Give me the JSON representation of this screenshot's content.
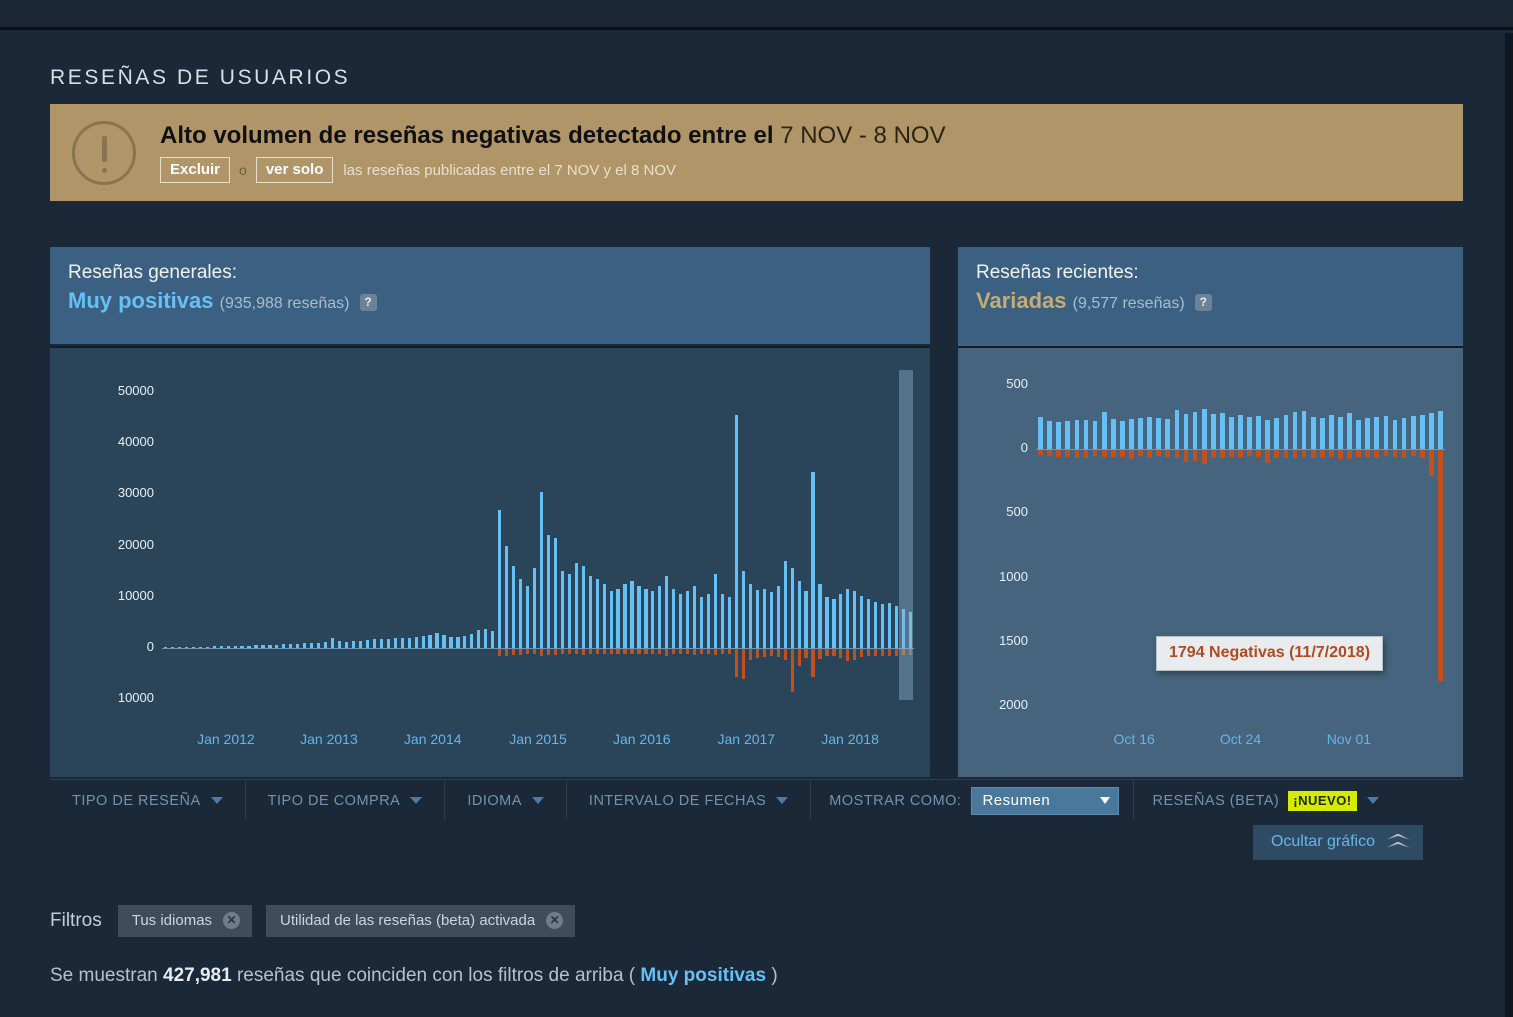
{
  "section": {
    "title": "RESEÑAS DE USUARIOS"
  },
  "warning": {
    "icon": "exclamation-circle-icon",
    "headline_bold": "Alto volumen de reseñas negativas detectado entre el ",
    "headline_range": "7 NOV - 8 NOV",
    "exclude_label": "Excluir",
    "or_label": "o",
    "only_label": "ver solo",
    "tail_text": "las reseñas publicadas entre el 7 NOV y el 8 NOV",
    "bg_color": "#b09569"
  },
  "overall": {
    "heading": "Reseñas generales:",
    "score": "Muy positivas",
    "count": "(935,988 reseñas)",
    "help_icon": "question-mark-icon",
    "score_color": "#66c0f4"
  },
  "recent": {
    "heading": "Reseñas recientes:",
    "score": "Variadas",
    "count": "(9,577 reseñas)",
    "help_icon": "question-mark-icon",
    "score_color": "#c7ab71"
  },
  "filter_bar": {
    "review_type": "TIPO DE RESEÑA",
    "purchase_type": "TIPO DE COMPRA",
    "language": "IDIOMA",
    "date_range": "INTERVALO DE FECHAS",
    "show_as_label": "MOSTRAR COMO:",
    "show_as_value": "Resumen",
    "show_as_options": [
      "Resumen"
    ],
    "beta_label": "RESEÑAS (BETA)",
    "beta_badge": "¡NUEVO!",
    "hide_graph": "Ocultar gráfico"
  },
  "filters": {
    "label": "Filtros",
    "chips": [
      {
        "text": "Tus idiomas",
        "remove_icon": "close-icon"
      },
      {
        "text": "Utilidad de las reseñas (beta) activada",
        "remove_icon": "close-icon"
      }
    ]
  },
  "summary": {
    "prefix": "Se muestran ",
    "count": "427,981",
    "middle": " reseñas que coinciden con los filtros de arriba ( ",
    "link": "Muy positivas",
    "suffix": " )"
  },
  "chart_data": [
    {
      "id": "overall-reviews-chart",
      "type": "bar",
      "title": "Reseñas generales",
      "xlabel": "",
      "ylabel": "",
      "grid": false,
      "legend": "none",
      "yticks": [
        "50000",
        "40000",
        "30000",
        "20000",
        "10000",
        "0",
        "10000"
      ],
      "ytick_values": [
        50000,
        40000,
        30000,
        20000,
        10000,
        0,
        -10000
      ],
      "ylim": [
        -14000,
        54000
      ],
      "xticks": [
        "Jan 2012",
        "Jan 2013",
        "Jan 2014",
        "Jan 2015",
        "Jan 2016",
        "Jan 2017",
        "Jan 2018"
      ],
      "colors": {
        "positive": "#66c0f4",
        "negative": "#c0501e"
      },
      "selection_highlight": "last month range",
      "series": [
        {
          "name": "Positivas",
          "color": "#66c0f4",
          "values": [
            120,
            130,
            140,
            150,
            160,
            170,
            200,
            260,
            300,
            280,
            320,
            330,
            360,
            420,
            480,
            520,
            560,
            600,
            700,
            760,
            820,
            880,
            940,
            1000,
            1900,
            1200,
            1150,
            1250,
            1350,
            1500,
            1600,
            1700,
            1750,
            1800,
            1850,
            1900,
            2100,
            2300,
            2500,
            2800,
            2400,
            2000,
            2100,
            2200,
            2600,
            3400,
            3600,
            3200,
            27000,
            20000,
            16000,
            13500,
            12000,
            15500,
            30500,
            22000,
            21500,
            15000,
            14500,
            16500,
            16000,
            14000,
            13500,
            12500,
            11000,
            11500,
            12500,
            13000,
            12000,
            11500,
            11000,
            12000,
            14000,
            11500,
            10500,
            11000,
            12000,
            10000,
            10500,
            14500,
            10500,
            10000,
            45500,
            15000,
            12500,
            11200,
            11500,
            10800,
            12000,
            17000,
            15500,
            13000,
            11000,
            34500,
            12500,
            10000,
            9500,
            10500,
            11500,
            11000,
            10200,
            9500,
            9000,
            8500,
            8800,
            8200,
            7500,
            7000
          ]
        },
        {
          "name": "Negativas",
          "color": "#c0501e",
          "values": [
            0,
            0,
            0,
            0,
            0,
            0,
            0,
            0,
            0,
            0,
            0,
            0,
            0,
            0,
            0,
            0,
            0,
            0,
            0,
            0,
            0,
            0,
            0,
            0,
            0,
            0,
            0,
            0,
            0,
            0,
            0,
            0,
            0,
            0,
            0,
            0,
            0,
            0,
            0,
            0,
            0,
            0,
            0,
            0,
            0,
            0,
            0,
            0,
            1500,
            1400,
            1300,
            1200,
            1100,
            1100,
            1500,
            1300,
            1200,
            1100,
            1100,
            1100,
            1200,
            1100,
            1000,
            1000,
            1000,
            1000,
            1100,
            1100,
            1100,
            1100,
            1000,
            1100,
            1400,
            1100,
            1000,
            1100,
            1200,
            1000,
            1100,
            1200,
            1100,
            1100,
            5500,
            6000,
            2200,
            1800,
            1600,
            1500,
            1700,
            2200,
            8500,
            3500,
            1900,
            5500,
            2000,
            1400,
            1500,
            1800,
            2400,
            2200,
            1600,
            1500,
            1400,
            1500,
            1500,
            1400,
            1300,
            1200
          ]
        }
      ]
    },
    {
      "id": "recent-reviews-chart",
      "type": "bar",
      "title": "Reseñas recientes",
      "xlabel": "",
      "ylabel": "",
      "grid": false,
      "legend": "none",
      "yticks": [
        "500",
        "0",
        "500",
        "1000",
        "1500",
        "2000"
      ],
      "ytick_values": [
        500,
        0,
        -500,
        -1000,
        -1500,
        -2000
      ],
      "ylim": [
        -2100,
        600
      ],
      "xticks": [
        "Oct 16",
        "Oct 24",
        "Nov 01"
      ],
      "colors": {
        "positive": "#66c0f4",
        "negative": "#c0501e"
      },
      "annotation": {
        "text": "1794 Negativas (11/7/2018)",
        "color": "#b04a23"
      },
      "series": [
        {
          "name": "Positivas",
          "color": "#66c0f4",
          "values": [
            250,
            215,
            210,
            215,
            225,
            230,
            215,
            290,
            235,
            220,
            235,
            240,
            250,
            240,
            235,
            305,
            275,
            290,
            310,
            275,
            280,
            250,
            265,
            250,
            260,
            230,
            240,
            265,
            290,
            300,
            250,
            240,
            265,
            250,
            280,
            230,
            240,
            250,
            260,
            230,
            240,
            255,
            265,
            280,
            300
          ]
        },
        {
          "name": "Negativas",
          "color": "#c0501e",
          "values": [
            40,
            48,
            50,
            55,
            58,
            62,
            48,
            50,
            55,
            50,
            68,
            45,
            58,
            48,
            55,
            60,
            95,
            85,
            110,
            62,
            58,
            55,
            50,
            45,
            52,
            100,
            60,
            58,
            62,
            50,
            60,
            65,
            55,
            72,
            70,
            52,
            55,
            60,
            48,
            55,
            58,
            48,
            60,
            200,
            1794
          ]
        }
      ]
    }
  ]
}
